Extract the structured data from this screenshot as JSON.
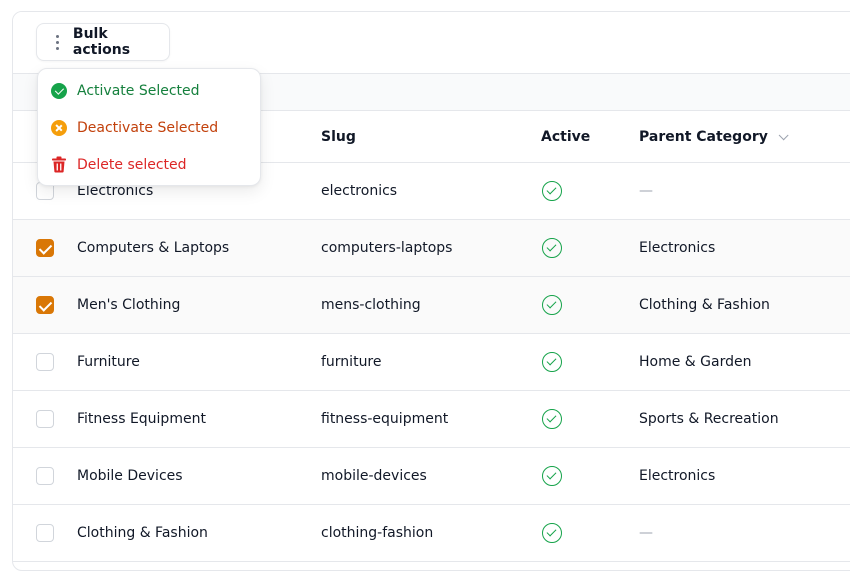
{
  "toolbar": {
    "bulk_actions_label": "Bulk actions"
  },
  "bulk_menu": {
    "items": [
      {
        "label": "Activate Selected",
        "icon": "check-circle-icon",
        "color": "#16a34a"
      },
      {
        "label": "Deactivate Selected",
        "icon": "x-circle-icon",
        "color": "#f59e0b"
      },
      {
        "label": "Delete selected",
        "icon": "trash-icon",
        "color": "#dc2626"
      }
    ]
  },
  "table": {
    "columns": {
      "slug": "Slug",
      "active": "Active",
      "parent": "Parent Category"
    },
    "rows": [
      {
        "name": "Electronics",
        "slug": "electronics",
        "active": true,
        "parent": "—",
        "selected": false
      },
      {
        "name": "Computers & Laptops",
        "slug": "computers-laptops",
        "active": true,
        "parent": "Electronics",
        "selected": true
      },
      {
        "name": "Men's Clothing",
        "slug": "mens-clothing",
        "active": true,
        "parent": "Clothing & Fashion",
        "selected": true
      },
      {
        "name": "Furniture",
        "slug": "furniture",
        "active": true,
        "parent": "Home & Garden",
        "selected": false
      },
      {
        "name": "Fitness Equipment",
        "slug": "fitness-equipment",
        "active": true,
        "parent": "Sports & Recreation",
        "selected": false
      },
      {
        "name": "Mobile Devices",
        "slug": "mobile-devices",
        "active": true,
        "parent": "Electronics",
        "selected": false
      },
      {
        "name": "Clothing & Fashion",
        "slug": "clothing-fashion",
        "active": true,
        "parent": "—",
        "selected": false
      }
    ]
  },
  "colors": {
    "accent": "#d97706",
    "active": "#16a34a"
  }
}
